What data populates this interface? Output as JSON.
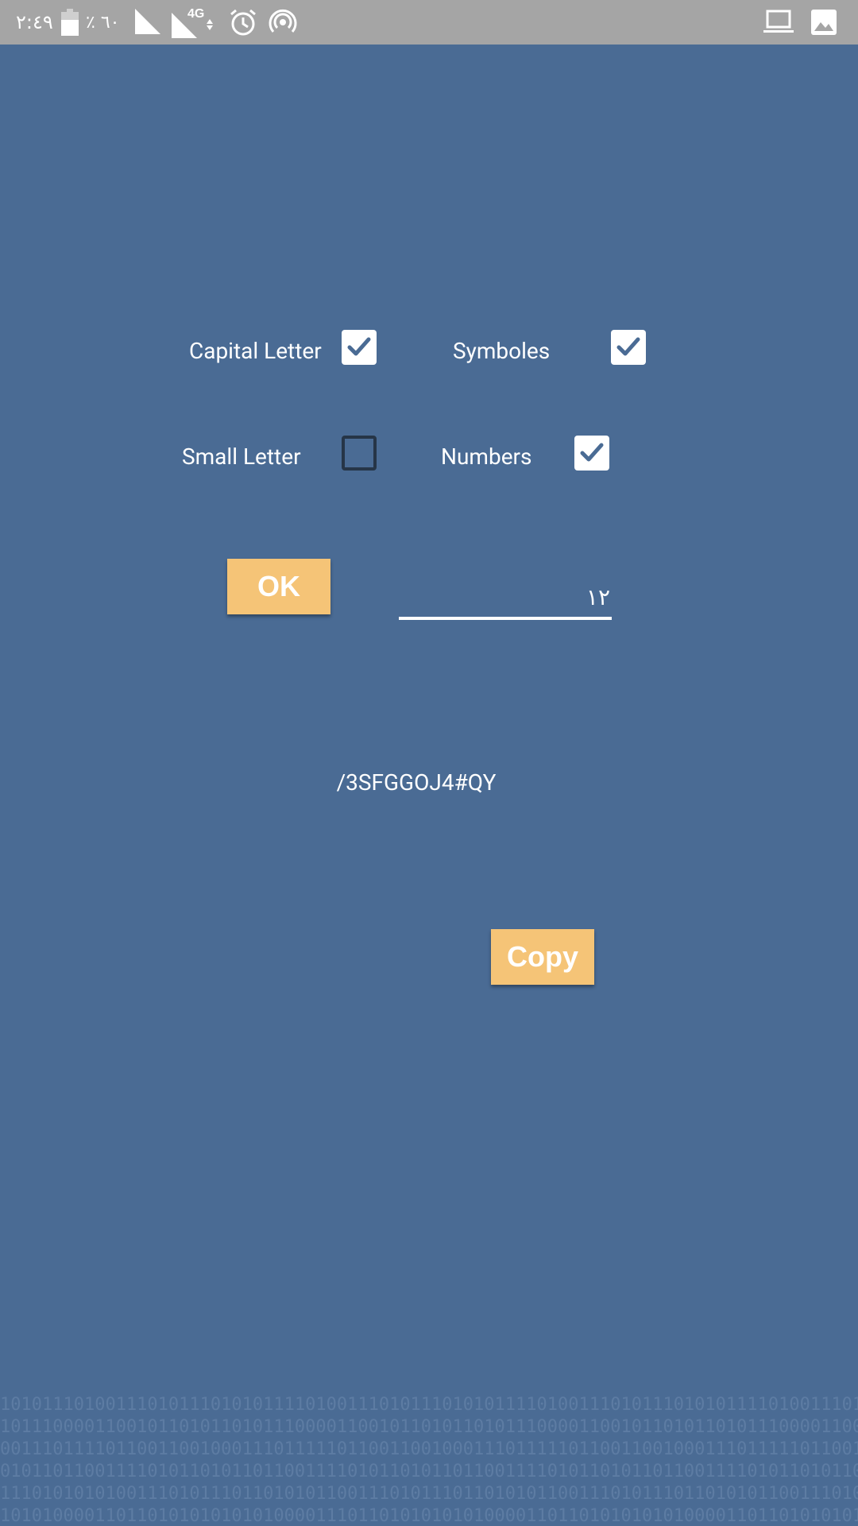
{
  "status_bar": {
    "time": "٢:٤٩",
    "battery_percent": "٪ ٦٠",
    "network": "4G",
    "icons": [
      "battery-icon",
      "signal-icon",
      "signal-4g-icon",
      "alarm-icon",
      "hotspot-icon",
      "laptop-icon",
      "image-icon"
    ]
  },
  "options": {
    "capital_letter": {
      "label": "Capital Letter",
      "checked": true
    },
    "symboles": {
      "label": "Symboles",
      "checked": true
    },
    "small_letter": {
      "label": "Small Letter",
      "checked": false
    },
    "numbers": {
      "label": "Numbers",
      "checked": true
    }
  },
  "ok_button": {
    "label": "OK"
  },
  "length_input": {
    "value": "١٢"
  },
  "generated_password": "/3SFGGOJ4#QY",
  "copy_button": {
    "label": "Copy"
  },
  "colors": {
    "background": "#4a6b94",
    "status_bar": "#a5a5a5",
    "button": "#f5c477",
    "checkmark": "#4a6b94"
  },
  "background_pattern": [
    "101011101001110101110101011110100111010111010101111010011101011101010111101001110101110101011110100111010111",
    "101110000110010110101101011100001100101101011010111000011001011010110101110000110010110101101011100001100101",
    "001110111101100110010001110111110110011001000111011111011001100100011101111101100110010001110111110110011001",
    "010110110011110101101011011001111010110101101100111101011010110110011110101101011011001111010110101101100111",
    "111010101010011101011101101010110011101011101101010110011101011101101010110011101011101101010110011101011101",
    "101010000110110101010101010000111011010101010100001101101010101010000110110101010101010000111011010101010100"
  ]
}
